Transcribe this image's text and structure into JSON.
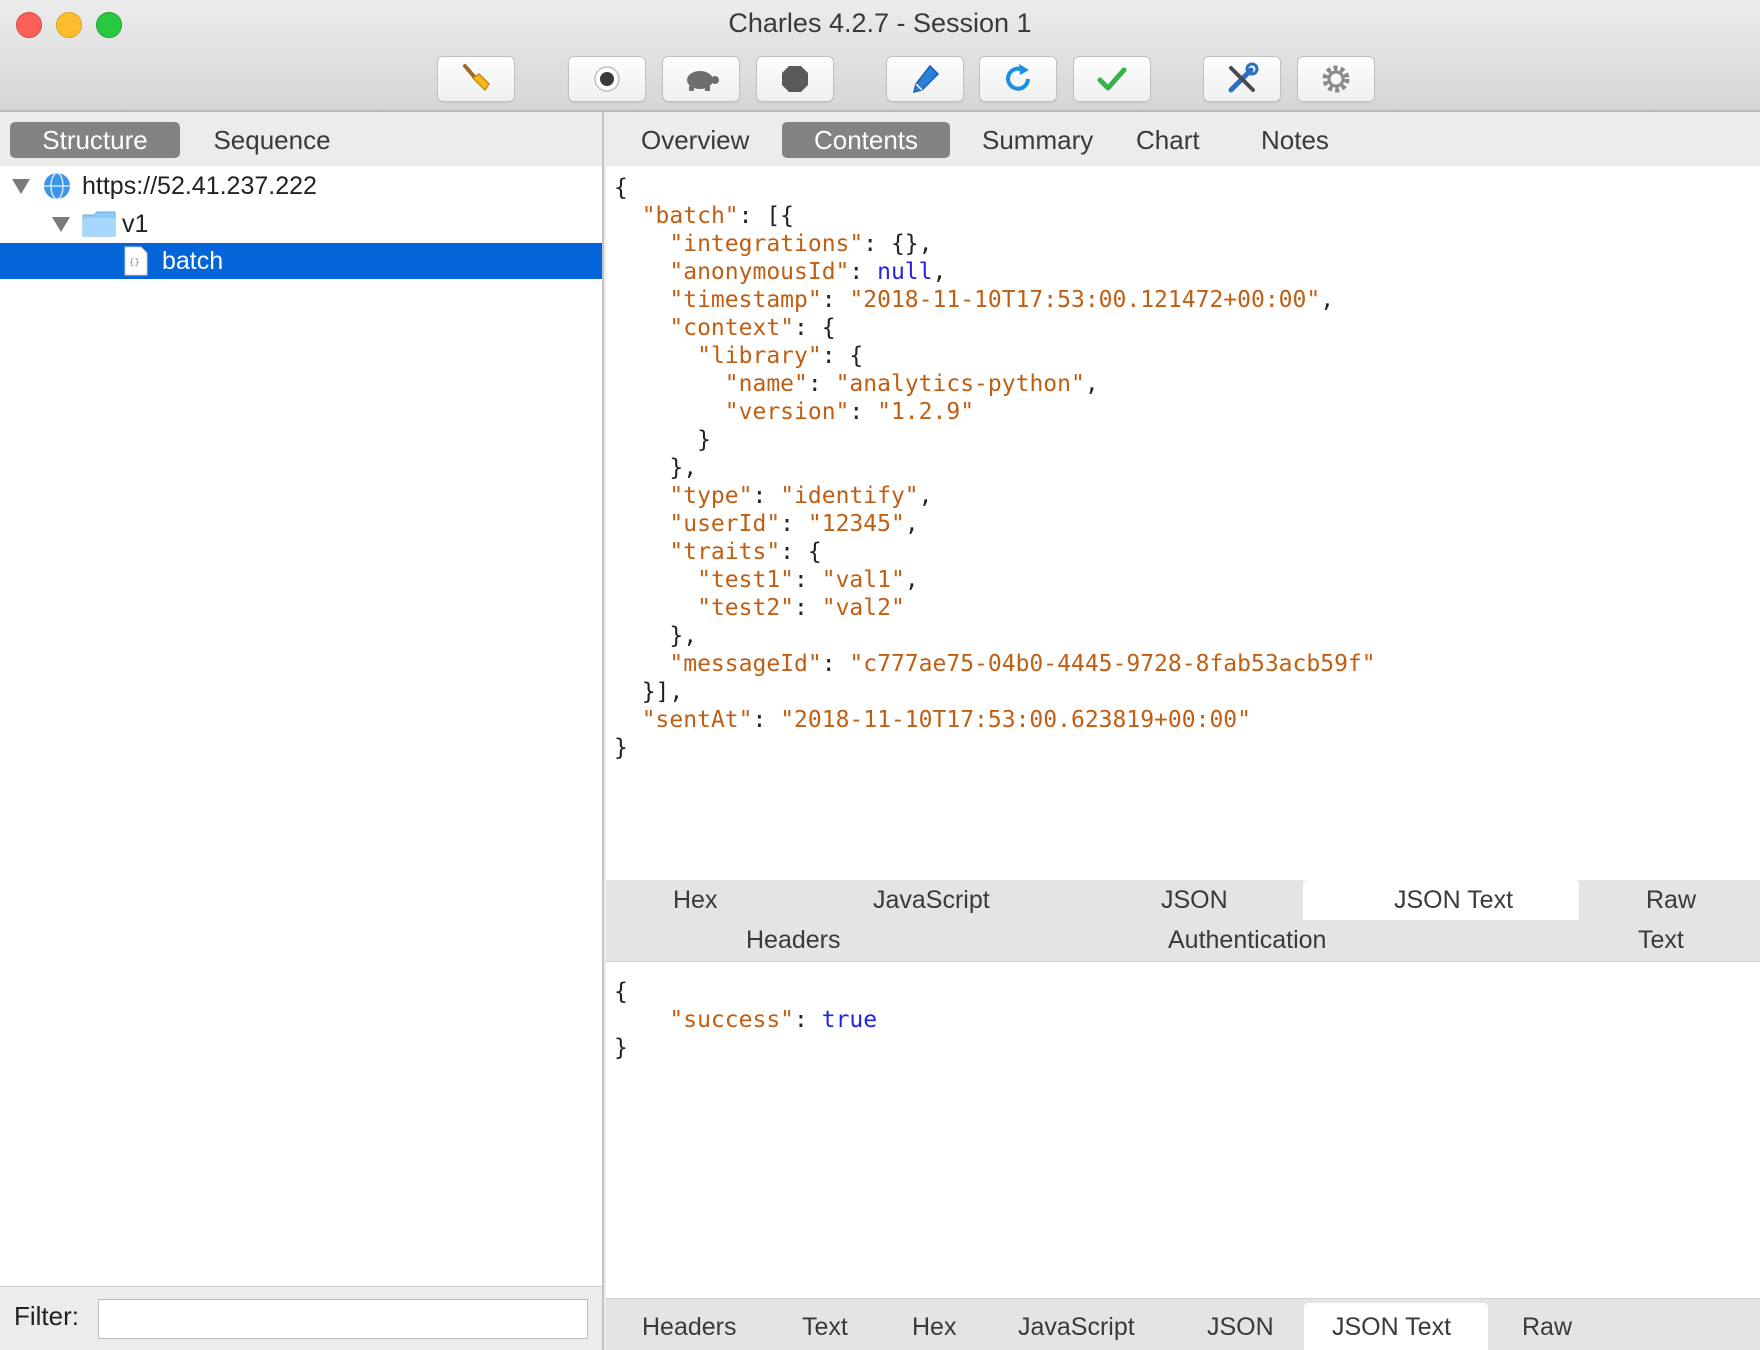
{
  "window": {
    "title": "Charles 4.2.7 - Session 1"
  },
  "toolbar": {
    "buttons": [
      {
        "name": "broom-icon"
      },
      {
        "name": "record-icon"
      },
      {
        "name": "throttle-turtle-icon"
      },
      {
        "name": "stop-hexagon-icon"
      },
      {
        "name": "compose-pen-icon"
      },
      {
        "name": "repeat-refresh-icon"
      },
      {
        "name": "validate-check-icon"
      },
      {
        "name": "tools-icon"
      },
      {
        "name": "settings-gear-icon"
      }
    ]
  },
  "left_panel": {
    "tabs": [
      "Structure",
      "Sequence"
    ],
    "active_tab": "Structure",
    "tree": [
      {
        "label": "https://52.41.237.222",
        "icon": "globe-icon",
        "expanded": true
      },
      {
        "label": "v1",
        "icon": "folder-icon",
        "expanded": true
      },
      {
        "label": "batch",
        "icon": "json-file-icon",
        "selected": true
      }
    ],
    "filter": {
      "label": "Filter:",
      "value": ""
    }
  },
  "right_panel": {
    "tabs": [
      "Overview",
      "Contents",
      "Summary",
      "Chart",
      "Notes"
    ],
    "active_tab": "Contents",
    "request_body": "{\n  \"batch\": [{\n    \"integrations\": {},\n    \"anonymousId\": null,\n    \"timestamp\": \"2018-11-10T17:53:00.121472+00:00\",\n    \"context\": {\n      \"library\": {\n        \"name\": \"analytics-python\",\n        \"version\": \"1.2.9\"\n      }\n    },\n    \"type\": \"identify\",\n    \"userId\": \"12345\",\n    \"traits\": {\n      \"test1\": \"val1\",\n      \"test2\": \"val2\"\n    },\n    \"messageId\": \"c777ae75-04b0-4445-9728-8fab53acb59f\"\n  }],\n  \"sentAt\": \"2018-11-10T17:53:00.623819+00:00\"\n}",
    "request_viewer_tabs_row1": [
      "Hex",
      "JavaScript",
      "JSON",
      "JSON Text",
      "Raw"
    ],
    "request_viewer_tabs_row2": [
      "Headers",
      "Authentication",
      "Text"
    ],
    "request_viewer_active": "JSON Text",
    "response_body": "{\n    \"success\": true\n}",
    "response_viewer_tabs": [
      "Headers",
      "Text",
      "Hex",
      "JavaScript",
      "JSON",
      "JSON Text",
      "Raw"
    ],
    "response_viewer_active": "JSON Text"
  }
}
